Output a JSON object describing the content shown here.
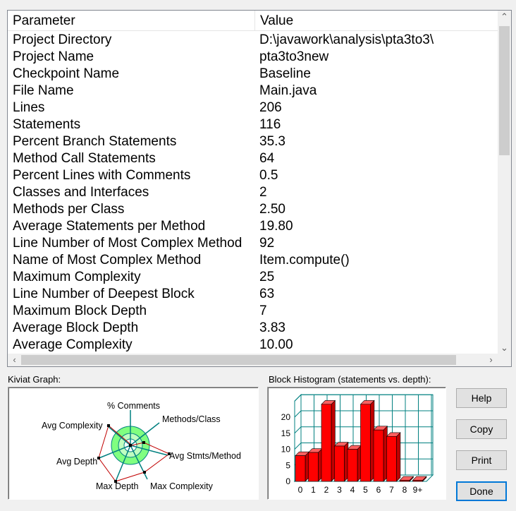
{
  "table": {
    "headers": [
      "Parameter",
      "Value"
    ],
    "rows": [
      [
        "Project Directory",
        "D:\\javawork\\analysis\\pta3to3\\"
      ],
      [
        "Project Name",
        "pta3to3new"
      ],
      [
        "Checkpoint Name",
        "Baseline"
      ],
      [
        "File Name",
        "Main.java"
      ],
      [
        "Lines",
        "206"
      ],
      [
        "Statements",
        "116"
      ],
      [
        "Percent Branch Statements",
        "35.3"
      ],
      [
        "Method Call Statements",
        "64"
      ],
      [
        "Percent Lines with Comments",
        "0.5"
      ],
      [
        "Classes and Interfaces",
        "2"
      ],
      [
        "Methods per Class",
        "2.50"
      ],
      [
        "Average Statements per Method",
        "19.80"
      ],
      [
        "Line Number of Most Complex Method",
        "92"
      ],
      [
        "Name of Most Complex Method",
        "Item.compute()"
      ],
      [
        "Maximum Complexity",
        "25"
      ],
      [
        "Line Number of Deepest Block",
        "63"
      ],
      [
        "Maximum Block Depth",
        "7"
      ],
      [
        "Average Block Depth",
        "3.83"
      ],
      [
        "Average Complexity",
        "10.00"
      ]
    ]
  },
  "kiviat": {
    "label": "Kiviat Graph:",
    "axes": [
      "% Comments",
      "Methods/Class",
      "Avg Stmts/Method",
      "Max Complexity",
      "Max Depth",
      "Avg Depth",
      "Avg Complexity"
    ]
  },
  "histogram": {
    "label": "Block Histogram (statements vs. depth):",
    "y_ticks": [
      "0",
      "5",
      "10",
      "15",
      "20"
    ],
    "x_ticks": [
      "0",
      "1",
      "2",
      "3",
      "4",
      "5",
      "6",
      "7",
      "8",
      "9+"
    ]
  },
  "chart_data": {
    "type": "bar",
    "categories": [
      "0",
      "1",
      "2",
      "3",
      "4",
      "5",
      "6",
      "7",
      "8",
      "9+"
    ],
    "values": [
      8,
      9,
      24,
      11,
      10,
      24,
      16,
      14,
      0,
      0
    ],
    "ylim": [
      0,
      25
    ],
    "grid": true
  },
  "buttons": {
    "help": "Help",
    "copy": "Copy",
    "print": "Print",
    "done": "Done"
  },
  "colors": {
    "bar": "#ff0000",
    "bar_side": "#c00000",
    "bar_top": "#ff6060",
    "kiviat_fill": "#80ff80",
    "kiviat_ring": "#c0ffc0",
    "accent": "#0078d7"
  }
}
